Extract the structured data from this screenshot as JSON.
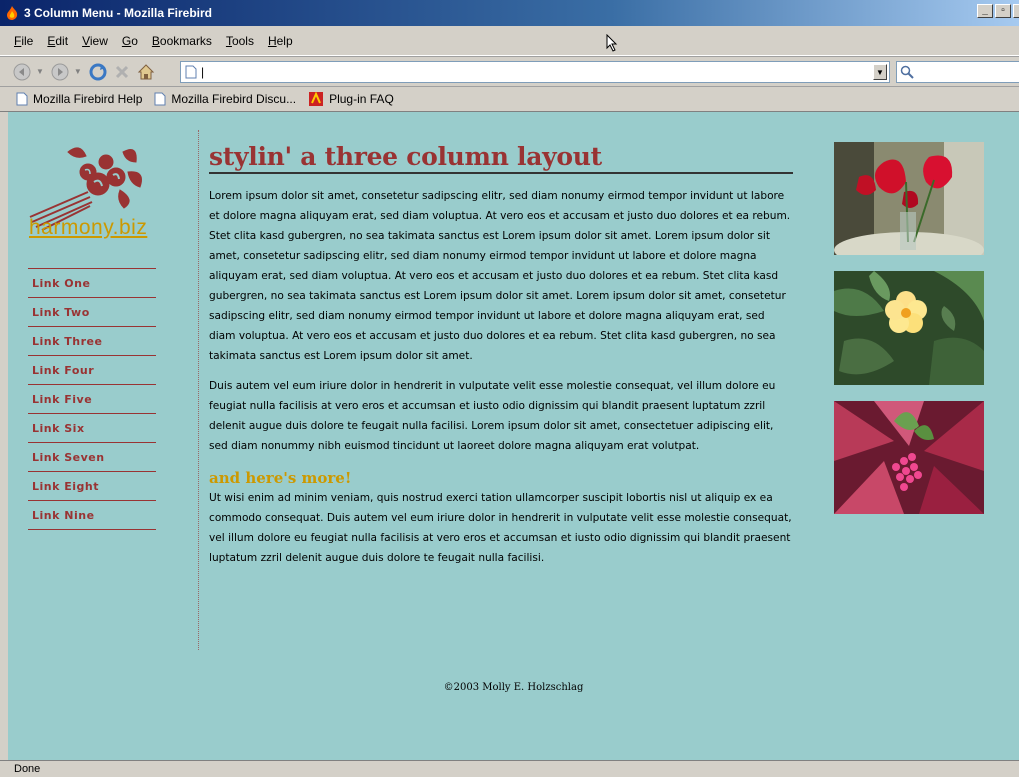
{
  "window": {
    "title": "3 Column Menu - Mozilla Firebird",
    "min_label": "_",
    "restore_label": "▫"
  },
  "menubar": {
    "items": [
      {
        "accel": "F",
        "rest": "ile"
      },
      {
        "accel": "E",
        "rest": "dit"
      },
      {
        "accel": "V",
        "rest": "iew"
      },
      {
        "accel": "G",
        "rest": "o"
      },
      {
        "accel": "B",
        "rest": "ookmarks"
      },
      {
        "accel": "T",
        "rest": "ools"
      },
      {
        "accel": "H",
        "rest": "elp"
      }
    ]
  },
  "navbar": {
    "url_value": "|"
  },
  "bookmarks": {
    "items": [
      {
        "label": "Mozilla Firebird Help"
      },
      {
        "label": "Mozilla Firebird Discu..."
      },
      {
        "label": "Plug-in FAQ"
      }
    ]
  },
  "page": {
    "logo_text": "harmony.biz",
    "nav_links": [
      "Link One",
      "Link Two",
      "Link Three",
      "Link Four",
      "Link Five",
      "Link Six",
      "Link Seven",
      "Link Eight",
      "Link Nine"
    ],
    "headline": "stylin' a three column layout",
    "para1": "Lorem ipsum dolor sit amet, consetetur sadipscing elitr, sed diam nonumy eirmod tempor invidunt ut labore et dolore magna aliquyam erat, sed diam voluptua. At vero eos et accusam et justo duo dolores et ea rebum. Stet clita kasd gubergren, no sea takimata sanctus est Lorem ipsum dolor sit amet. Lorem ipsum dolor sit amet, consetetur sadipscing elitr, sed diam nonumy eirmod tempor invidunt ut labore et dolore magna aliquyam erat, sed diam voluptua. At vero eos et accusam et justo duo dolores et ea rebum. Stet clita kasd gubergren, no sea takimata sanctus est Lorem ipsum dolor sit amet. Lorem ipsum dolor sit amet, consetetur sadipscing elitr, sed diam nonumy eirmod tempor invidunt ut labore et dolore magna aliquyam erat, sed diam voluptua. At vero eos et accusam et justo duo dolores et ea rebum. Stet clita kasd gubergren, no sea takimata sanctus est Lorem ipsum dolor sit amet.",
    "para2": "Duis autem vel eum iriure dolor in hendrerit in vulputate velit esse molestie consequat, vel illum dolore eu feugiat nulla facilisis at vero eros et accumsan et iusto odio dignissim qui blandit praesent luptatum zzril delenit augue duis dolore te feugait nulla facilisi. Lorem ipsum dolor sit amet, consectetuer adipiscing elit, sed diam nonummy nibh euismod tincidunt ut laoreet dolore magna aliquyam erat volutpat.",
    "subhead": "and here's more!",
    "para3": "Ut wisi enim ad minim veniam, quis nostrud exerci tation ullamcorper suscipit lobortis nisl ut aliquip ex ea commodo consequat. Duis autem vel eum iriure dolor in hendrerit in vulputate velit esse molestie consequat, vel illum dolore eu feugiat nulla facilisis at vero eros et accumsan et iusto odio dignissim qui blandit praesent luptatum zzril delenit augue duis dolore te feugait nulla facilisi.",
    "footer": "©2003 Molly E. Holzschlag"
  },
  "status": {
    "text": "Done"
  },
  "colors": {
    "page_bg": "#99cccc",
    "link": "#993333",
    "accent": "#cc9900",
    "headline": "#993333"
  }
}
